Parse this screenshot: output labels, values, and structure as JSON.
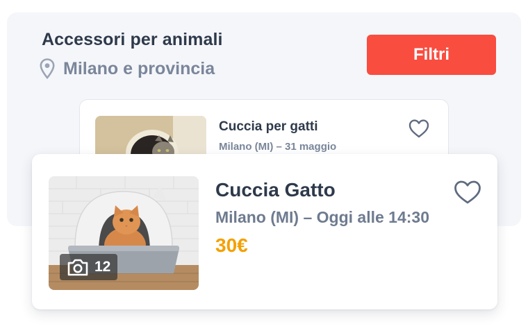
{
  "header": {
    "title": "Accessori per animali",
    "location": "Milano e provincia",
    "filter_label": "Filtri"
  },
  "listings": [
    {
      "title": "Cuccia per gatti",
      "subtitle": "Milano (MI) – 31 maggio",
      "favorite_icon": "heart-outline-icon"
    },
    {
      "title": "Cuccia Gatto",
      "subtitle": "Milano (MI) – Oggi alle 14:30",
      "price": "30€",
      "photo_count": "12",
      "favorite_icon": "heart-outline-icon"
    }
  ],
  "colors": {
    "accent": "#f94d40",
    "price": "#f4a000",
    "text": "#2e3a4b",
    "muted": "#7a869a",
    "panel": "#f5f6fa"
  }
}
